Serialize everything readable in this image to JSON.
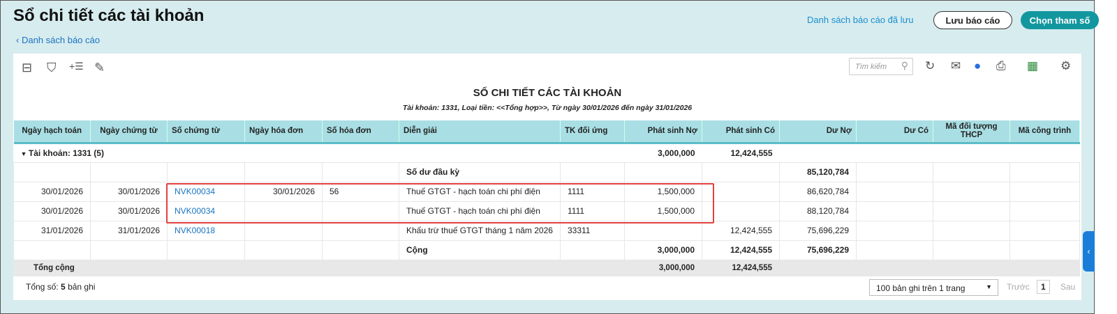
{
  "header": {
    "title": "Sổ chi tiết các tài khoản",
    "back": "Danh sách báo cáo",
    "saved_reports": "Danh sách báo cáo đã lưu",
    "save_btn": "Lưu báo cáo",
    "param_btn": "Chọn tham số"
  },
  "toolbar": {
    "search_placeholder": "Tìm kiếm"
  },
  "report": {
    "title": "SỔ CHI TIẾT CÁC TÀI KHOẢN",
    "subtitle": "Tài khoản: 1331, Loại tiền: <<Tổng hợp>>, Từ ngày 30/01/2026 đến ngày 31/01/2026"
  },
  "columns": [
    "Ngày hạch toán",
    "Ngày chứng từ",
    "Số chứng từ",
    "Ngày hóa đơn",
    "Số hóa đơn",
    "Diễn giải",
    "TK đối ứng",
    "Phát sinh Nợ",
    "Phát sinh Có",
    "Dư Nợ",
    "Dư Có",
    "Mã đối tượng THCP",
    "Mã công trình"
  ],
  "group": {
    "label": "Tài khoản: 1331 (5)",
    "debit": "3,000,000",
    "credit": "12,424,555"
  },
  "opening": {
    "label": "Số dư đầu kỳ",
    "balance": "85,120,784"
  },
  "rows": [
    {
      "d1": "30/01/2026",
      "d2": "30/01/2026",
      "doc": "NVK00034",
      "invdate": "30/01/2026",
      "invno": "56",
      "desc": "Thuế GTGT - hạch toán chi phí điện",
      "acc": "1111",
      "debit": "1,500,000",
      "credit": "",
      "bal": "86,620,784"
    },
    {
      "d1": "30/01/2026",
      "d2": "30/01/2026",
      "doc": "NVK00034",
      "invdate": "",
      "invno": "",
      "desc": "Thuế GTGT - hạch toán chi phí điện",
      "acc": "1111",
      "debit": "1,500,000",
      "credit": "",
      "bal": "88,120,784"
    },
    {
      "d1": "31/01/2026",
      "d2": "31/01/2026",
      "doc": "NVK00018",
      "invdate": "",
      "invno": "",
      "desc": "Khấu trừ thuế GTGT tháng 1 năm 2026",
      "acc": "33311",
      "debit": "",
      "credit": "12,424,555",
      "bal": "75,696,229"
    }
  ],
  "sum": {
    "label": "Cộng",
    "debit": "3,000,000",
    "credit": "12,424,555",
    "balance": "75,696,229"
  },
  "total": {
    "label": "Tổng cộng",
    "debit": "3,000,000",
    "credit": "12,424,555"
  },
  "footer": {
    "count_label": "Tổng số:",
    "count": "5",
    "count_suffix": "bản ghi",
    "page_size": "100 bản ghi trên 1 trang",
    "prev": "Trước",
    "page": "1",
    "next": "Sau"
  }
}
